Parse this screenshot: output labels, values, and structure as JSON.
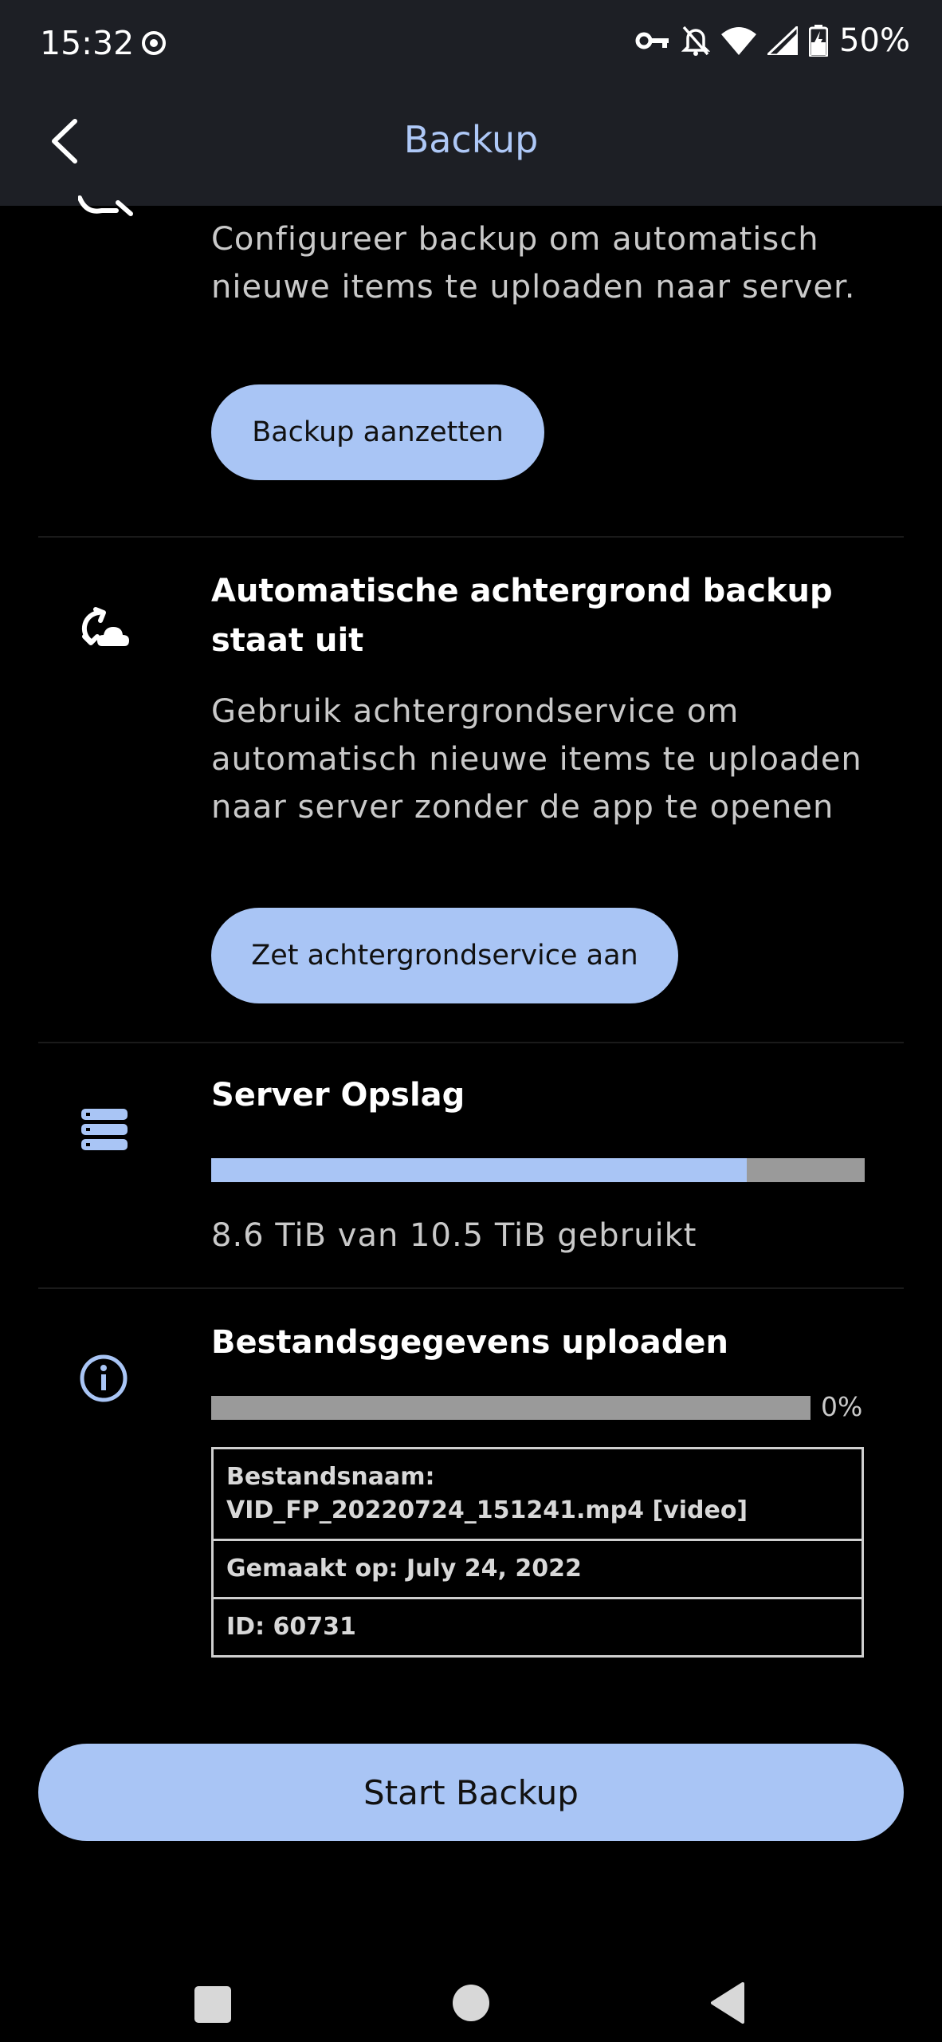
{
  "status_bar": {
    "time": "15:32",
    "battery": "50%"
  },
  "app_bar": {
    "title": "Backup"
  },
  "backup_section": {
    "description": "Configureer backup om automatisch nieuwe items te uploaden naar server.",
    "button_label": "Backup aanzetten"
  },
  "background_section": {
    "title": "Automatische achtergrond backup staat uit",
    "description": "Gebruik achtergrondservice om automatisch nieuwe items te uploaden naar server zonder de app te openen",
    "button_label": "Zet achtergrondservice aan"
  },
  "storage_section": {
    "title": "Server Opslag",
    "usage_text": "8.6 TiB van 10.5 TiB gebruikt",
    "used_fraction": 0.82
  },
  "upload_section": {
    "title": "Bestandsgegevens uploaden",
    "progress_percent": "0%",
    "rows": [
      "Bestandsnaam: VID_FP_20220724_151241.mp4 [video]",
      "Gemaakt op: July 24, 2022",
      "ID: 60731"
    ]
  },
  "start_button": {
    "label": "Start Backup"
  },
  "colors": {
    "accent": "#a9c5f5",
    "title": "#aec8f7",
    "appbar": "#1d1f25",
    "background": "#000000"
  }
}
